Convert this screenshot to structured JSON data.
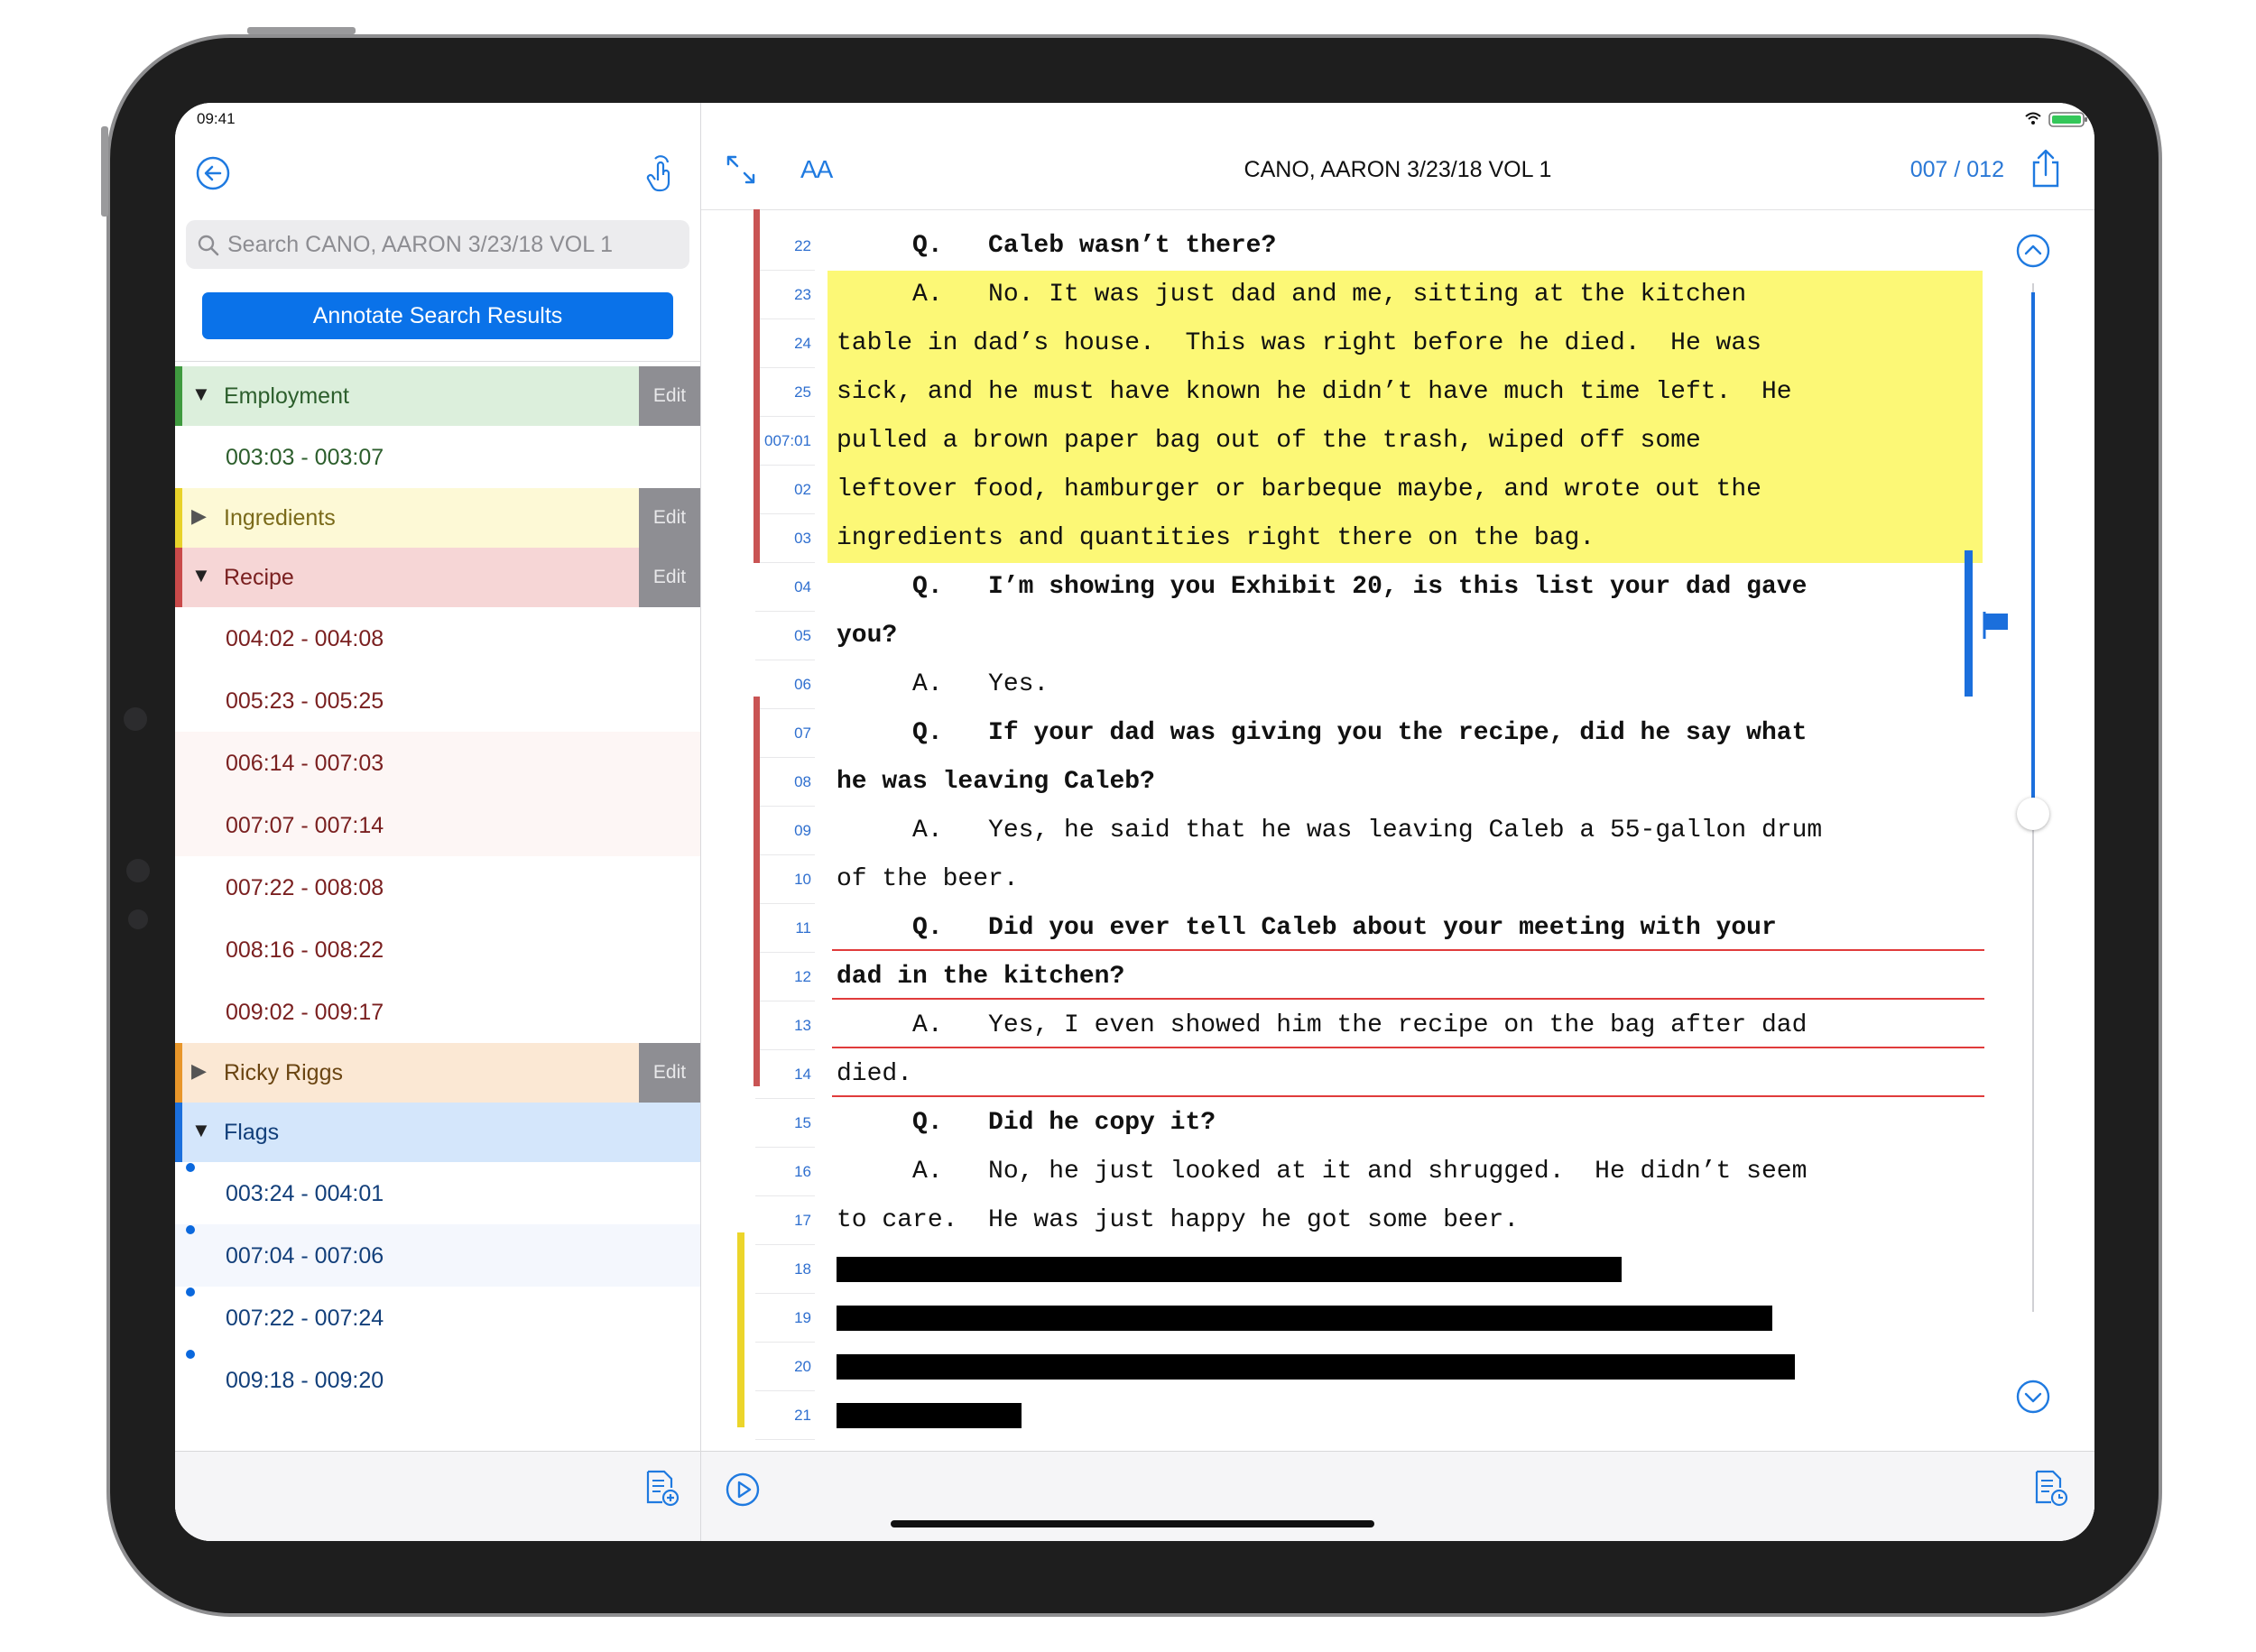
{
  "status": {
    "time": "09:41"
  },
  "sidebar": {
    "search_placeholder": "Search CANO, AARON 3/23/18 VOL 1",
    "annotate_label": "Annotate Search Results",
    "edit_label": "Edit",
    "categories": [
      {
        "name": "Employment",
        "color": "#3f9a3f",
        "bg": "#dcefdc",
        "text": "#2c5e2c",
        "expanded": true,
        "ranges": [
          "003:03 - 003:07"
        ]
      },
      {
        "name": "Ingredients",
        "color": "#e8d22a",
        "bg": "#fdf9d6",
        "text": "#7a6a1a",
        "expanded": false,
        "ranges": []
      },
      {
        "name": "Recipe",
        "color": "#c94a4a",
        "bg": "#f6d6d6",
        "text": "#7a2020",
        "expanded": true,
        "ranges": [
          "004:02 - 004:08",
          "005:23 - 005:25",
          "006:14 - 007:03",
          "007:07 - 007:14",
          "007:22 - 008:08",
          "008:16 - 008:22",
          "009:02 - 009:17"
        ]
      },
      {
        "name": "Ricky Riggs",
        "color": "#e8962a",
        "bg": "#fbe8d4",
        "text": "#6a4512",
        "expanded": false,
        "ranges": []
      },
      {
        "name": "Flags",
        "color": "#1b6fdc",
        "bg": "#d4e6fb",
        "text": "#123f7a",
        "expanded": true,
        "ranges": [
          "003:24 - 004:01",
          "007:04 - 007:06",
          "007:22 - 007:24",
          "009:18 - 009:20"
        ]
      }
    ]
  },
  "header": {
    "title": "CANO, AARON 3/23/18 VOL 1",
    "page": "007 / 012",
    "font_label": "AA"
  },
  "transcript": {
    "lines": [
      {
        "num": "22",
        "text": "     Q.   Caleb wasn’t there?",
        "bold": true
      },
      {
        "num": "23",
        "text": "     A.   No. It was just dad and me, sitting at the kitchen",
        "bold": false
      },
      {
        "num": "24",
        "text": "table in dad’s house.  This was right before he died.  He was",
        "bold": false
      },
      {
        "num": "25",
        "text": "sick, and he must have known he didn’t have much time left.  He",
        "bold": false
      },
      {
        "num": "007:01",
        "text": "pulled a brown paper bag out of the trash, wiped off some",
        "bold": false
      },
      {
        "num": "02",
        "text": "leftover food, hamburger or barbeque maybe, and wrote out the",
        "bold": false
      },
      {
        "num": "03",
        "text": "ingredients and quantities right there on the bag.",
        "bold": false
      },
      {
        "num": "04",
        "text": "     Q.   I’m showing you Exhibit 20, is this list your dad gave",
        "bold": true
      },
      {
        "num": "05",
        "text": "you?",
        "bold": true
      },
      {
        "num": "06",
        "text": "     A.   Yes.",
        "bold": false
      },
      {
        "num": "07",
        "text": "     Q.   If your dad was giving you the recipe, did he say what",
        "bold": true
      },
      {
        "num": "08",
        "text": "he was leaving Caleb?",
        "bold": true
      },
      {
        "num": "09",
        "text": "     A.   Yes, he said that he was leaving Caleb a 55-gallon drum",
        "bold": false
      },
      {
        "num": "10",
        "text": "of the beer.",
        "bold": false
      },
      {
        "num": "11",
        "text": "     Q.   Did you ever tell Caleb about your meeting with your",
        "bold": true
      },
      {
        "num": "12",
        "text": "dad in the kitchen?",
        "bold": true
      },
      {
        "num": "13",
        "text": "     A.   Yes, I even showed him the recipe on the bag after dad",
        "bold": false
      },
      {
        "num": "14",
        "text": "died.",
        "bold": false
      },
      {
        "num": "15",
        "text": "     Q.   Did he copy it?",
        "bold": true
      },
      {
        "num": "16",
        "text": "     A.   No, he just looked at it and shrugged.  He didn’t seem",
        "bold": false
      },
      {
        "num": "17",
        "text": "to care.  He was just happy he got some beer.",
        "bold": false
      },
      {
        "num": "18",
        "text": "",
        "bold": false,
        "redacted": 0.68
      },
      {
        "num": "19",
        "text": "",
        "bold": false,
        "redacted": 0.81
      },
      {
        "num": "20",
        "text": "",
        "bold": false,
        "redacted": 0.83
      },
      {
        "num": "21",
        "text": "",
        "bold": false,
        "redacted": 0.16
      }
    ]
  },
  "colors": {
    "accent": "#0a72e9",
    "highlight": "#fcf876",
    "recipe": "#c95454",
    "flag": "#1b6fdc",
    "ingredients": "#ecd52a"
  }
}
